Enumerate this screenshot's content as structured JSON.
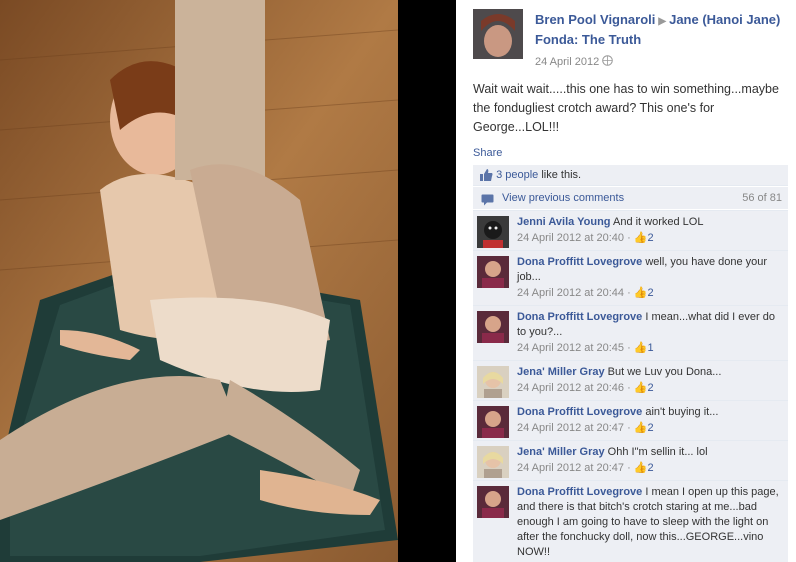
{
  "post": {
    "author": "Bren Pool Vignaroli",
    "target": "Jane (Hanoi Jane) Fonda: The Truth",
    "date": "24 April 2012",
    "text": "Wait wait wait.....this one has to win something...maybe the fondugliest crotch award? This one's for George...LOL!!!",
    "share_label": "Share",
    "likes_label": "3 people",
    "likes_suffix": " like this.",
    "view_previous_label": "View previous comments",
    "comment_count": "56 of 81"
  },
  "comments": [
    {
      "name": "Jenni Avila Young",
      "text": "And it worked LOL",
      "date": "24 April 2012 at 20:40",
      "likes": "2"
    },
    {
      "name": "Dona Proffitt Lovegrove",
      "text": "well, you have done your job...",
      "date": "24 April 2012 at 20:44",
      "likes": "2"
    },
    {
      "name": "Dona Proffitt Lovegrove",
      "text": "I mean...what did I ever do to you?...",
      "date": "24 April 2012 at 20:45",
      "likes": "1"
    },
    {
      "name": "Jena' Miller Gray",
      "text": "But we Luv you Dona...",
      "date": "24 April 2012 at 20:46",
      "likes": "2"
    },
    {
      "name": "Dona Proffitt Lovegrove",
      "text": "ain't buying it...",
      "date": "24 April 2012 at 20:47",
      "likes": "2"
    },
    {
      "name": "Jena' Miller Gray",
      "text": "Ohh I\"m sellin it... lol",
      "date": "24 April 2012 at 20:47",
      "likes": "2"
    },
    {
      "name": "Dona Proffitt Lovegrove",
      "text": "I mean I open up this page, and there is that bitch's crotch staring at me...bad enough I am going to have to sleep with the light on after the fonchucky doll, now this...GEORGE...vino NOW!!",
      "date": "",
      "likes": ""
    }
  ],
  "meta_separator": " · ",
  "icons": {
    "globe": "globe-icon",
    "thumb": "thumb-up-icon",
    "arrow": "arrow-right-icon"
  },
  "colors": {
    "link": "#3b5998",
    "panel_bg": "#edeff4",
    "meta": "#888888"
  }
}
